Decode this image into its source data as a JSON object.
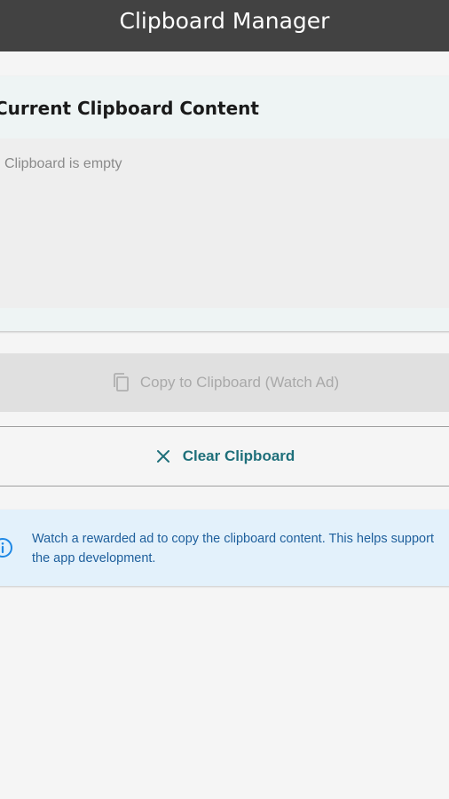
{
  "appbar": {
    "title": "Clipboard Manager"
  },
  "clipboard_card": {
    "title": "Current Clipboard Content",
    "content_text": "Clipboard is empty"
  },
  "copy_button": {
    "label": "Copy to Clipboard (Watch Ad)",
    "icon": "copy-icon",
    "enabled": false
  },
  "clear_button": {
    "label": "Clear Clipboard",
    "icon": "close-icon"
  },
  "info_banner": {
    "icon": "info-icon",
    "text": "Watch a rewarded ad to copy the clipboard content. This helps support the app development."
  },
  "colors": {
    "appbar": "#424242",
    "accent": "#1e6f7a",
    "info_background": "#e3f1fb",
    "info_text": "#1e5f9c"
  }
}
